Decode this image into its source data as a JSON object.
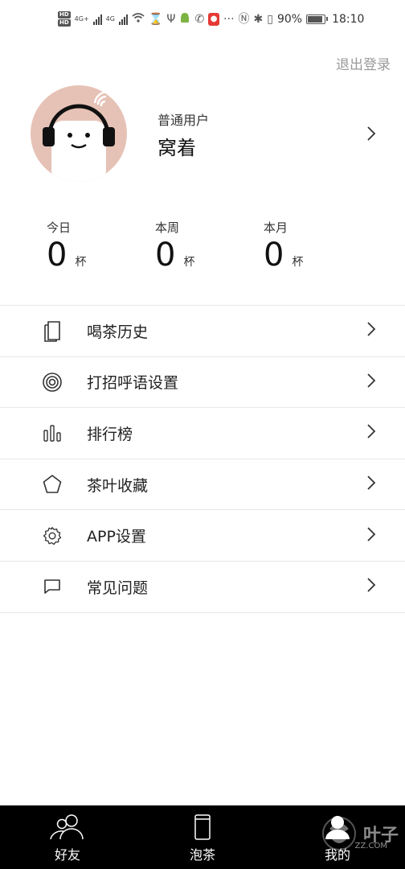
{
  "status_bar": {
    "hd1": "HD",
    "hd2": "HD",
    "network1": "4G+",
    "network2": "4G",
    "more": "···",
    "battery_percent": "90%",
    "battery_level": 0.9,
    "time": "18:10",
    "icons": [
      "hd-icon",
      "signal-icon",
      "wifi-icon",
      "hourglass-icon",
      "usb-icon",
      "android-icon",
      "phone-icon",
      "mic-icon",
      "nfc-icon",
      "bluetooth-icon",
      "vibrate-icon",
      "battery-icon"
    ]
  },
  "header": {
    "logout_label": "退出登录"
  },
  "profile": {
    "user_type": "普通用户",
    "username": "窝着",
    "avatar_icon": "headphone-avatar-icon"
  },
  "stats": [
    {
      "label": "今日",
      "value": "0",
      "unit": "杯"
    },
    {
      "label": "本周",
      "value": "0",
      "unit": "杯"
    },
    {
      "label": "本月",
      "value": "0",
      "unit": "杯"
    }
  ],
  "menu": [
    {
      "label": "喝茶历史",
      "icon": "history-icon"
    },
    {
      "label": "打招呼语设置",
      "icon": "target-icon"
    },
    {
      "label": "排行榜",
      "icon": "bar-chart-icon"
    },
    {
      "label": "茶叶收藏",
      "icon": "star-icon"
    },
    {
      "label": "APP设置",
      "icon": "gear-icon"
    },
    {
      "label": "常见问题",
      "icon": "chat-bubble-icon"
    }
  ],
  "tabs": [
    {
      "label": "好友",
      "icon": "friends-icon"
    },
    {
      "label": "泡茶",
      "icon": "cup-icon"
    },
    {
      "label": "我的",
      "icon": "profile-icon"
    }
  ],
  "watermark": {
    "text": "叶子",
    "subtext": "ZZ.COM"
  },
  "colors": {
    "avatar_bg": "#e6c2b6",
    "tabbar_bg": "#000000",
    "logout_text": "#9a9a9a"
  }
}
